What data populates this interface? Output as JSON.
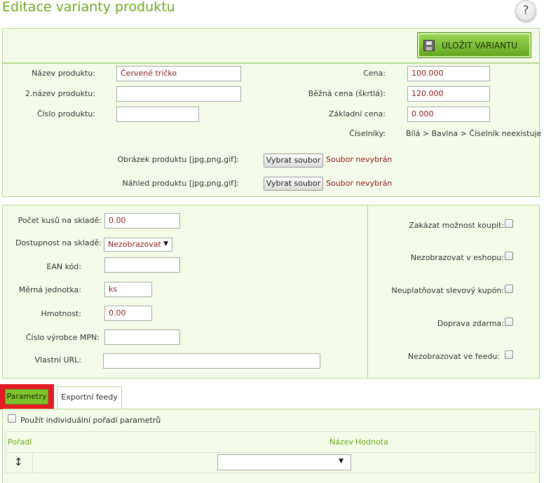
{
  "page": {
    "title": "Editace varianty produktu",
    "help_glyph": "?"
  },
  "toolbar": {
    "save_label": "ULOŽIT VARIANTU",
    "save_icon": "floppy-disk-icon"
  },
  "product": {
    "name_label": "Název produktu:",
    "name_value": "Červené tričko",
    "name2_label": "2.název produktu:",
    "name2_value": "",
    "number_label": "Číslo produktu:",
    "number_value": "",
    "price_label": "Cena:",
    "price_value": "100.000",
    "regular_price_label": "Běžná cena (škrtlá):",
    "regular_price_value": "120.000",
    "base_price_label": "Základní cena:",
    "base_price_value": "0.000",
    "codelists_label": "Číselníky:",
    "codelists_value": "Bílá > Bavlna > Číselník neexistuje",
    "image_label": "Obrázek produktu [jpg,png,gif]:",
    "thumb_label": "Náhled produktu [jpg,png,gif]:",
    "choose_file_label": "Vybrat soubor",
    "no_file_text": "Soubor nevybrán"
  },
  "stock": {
    "count_label": "Počet kusů na skladě:",
    "count_value": "0.00",
    "availability_label": "Dostupnost na skladě:",
    "availability_value": "Nezobrazovat",
    "ean_label": "EAN kód:",
    "ean_value": "",
    "unit_label": "Měrná jednotka:",
    "unit_value": "ks",
    "weight_label": "Hmotnost:",
    "weight_value": "0.00",
    "mpn_label": "Číslo výrobce MPN:",
    "mpn_value": "",
    "url_label": "Vlastní URL:",
    "url_value": ""
  },
  "flags": [
    {
      "label": "Zakázat možnost koupit:",
      "checked": false
    },
    {
      "label": "Nezobrazovat v eshopu:",
      "checked": false
    },
    {
      "label": "Neuplatňovat slevový kupón:",
      "checked": false
    },
    {
      "label": "Doprava zdarma:",
      "checked": false
    },
    {
      "label": "Nezobrazovat ve feedu:",
      "checked": false
    }
  ],
  "tabs": [
    {
      "label": "Parametry",
      "active": true
    },
    {
      "label": "Exportní feedy",
      "active": false
    }
  ],
  "params": {
    "individual_order_label": "Použít individuální pořadí parametrů",
    "col_order": "Pořadí",
    "col_name": "Název",
    "col_value": "Hodnota",
    "row_handle_icon": "drag-updown-icon",
    "select_value": ""
  },
  "colors": {
    "accent": "#6aaa19",
    "panel_bg": "#f3fbe8",
    "panel_border": "#b6d98f",
    "highlight": "#e31b23",
    "value_text": "#8b1a1a"
  }
}
